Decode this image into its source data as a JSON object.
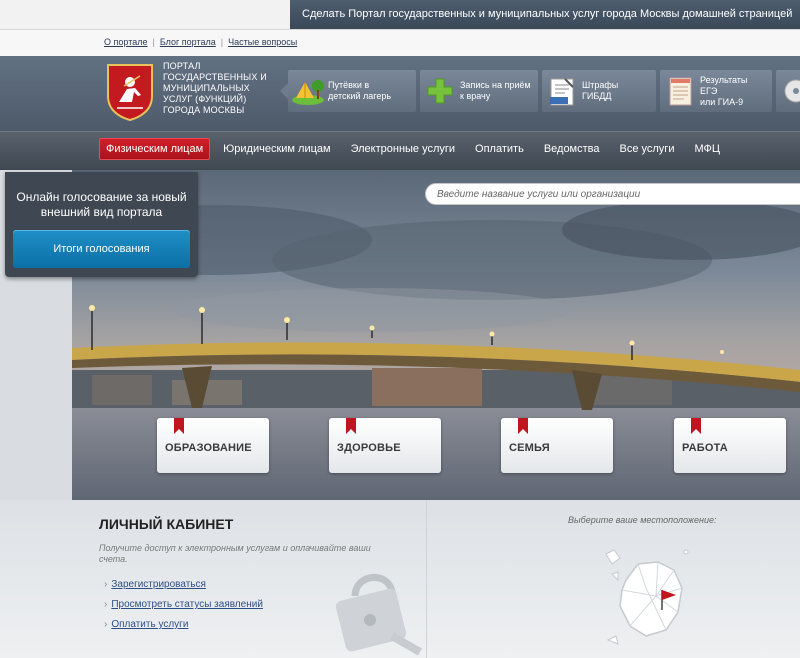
{
  "top_bar": {
    "promo": "Сделать Портал государственных и муниципальных услуг города Москвы домашней страницей"
  },
  "links": [
    "О портале",
    "Блог портала",
    "Частые вопросы"
  ],
  "header": {
    "title_lines": [
      "ПОРТАЛ",
      "ГОСУДАРСТВЕННЫХ И",
      "МУНИЦИПАЛЬНЫХ",
      "УСЛУГ (ФУНКЦИЙ)",
      "ГОРОДА МОСКВЫ"
    ],
    "quick_links": [
      {
        "line1": "Путёвки в",
        "line2": "детский лагерь",
        "icon": "camp-icon"
      },
      {
        "line1": "Запись на приём",
        "line2": "к врачу",
        "icon": "medical-cross-icon"
      },
      {
        "line1": "Штрафы ГИБДД",
        "line2": "",
        "icon": "traffic-fine-icon"
      },
      {
        "line1": "Результаты ЕГЭ",
        "line2": "или ГИА-9",
        "icon": "exam-sheet-icon"
      }
    ]
  },
  "nav": [
    "Физическим лицам",
    "Юридическим лицам",
    "Электронные услуги",
    "Оплатить",
    "Ведомства",
    "Все услуги",
    "МФЦ"
  ],
  "vote": {
    "line1": "Онлайн голосование за новый",
    "line2": "внешний вид портала",
    "button": "Итоги голосования"
  },
  "search": {
    "placeholder": "Введите название услуги или организации"
  },
  "categories": [
    "ОБРАЗОВАНИЕ",
    "ЗДОРОВЬЕ",
    "СЕМЬЯ",
    "РАБОТА"
  ],
  "cabinet": {
    "title": "ЛИЧНЫЙ КАБИНЕТ",
    "desc_line1": "Получите доступ к электронным услугам и оплачивайте ваши",
    "desc_line2": "счета.",
    "links": [
      "Зарегистрироваться",
      "Просмотреть статусы заявлений",
      "Оплатить услуги"
    ]
  },
  "location": {
    "title": "Выберите ваше местоположение:"
  },
  "colors": {
    "accent_red": "#c0141e",
    "button_blue": "#127bb3",
    "header_gray": "#57636f"
  }
}
